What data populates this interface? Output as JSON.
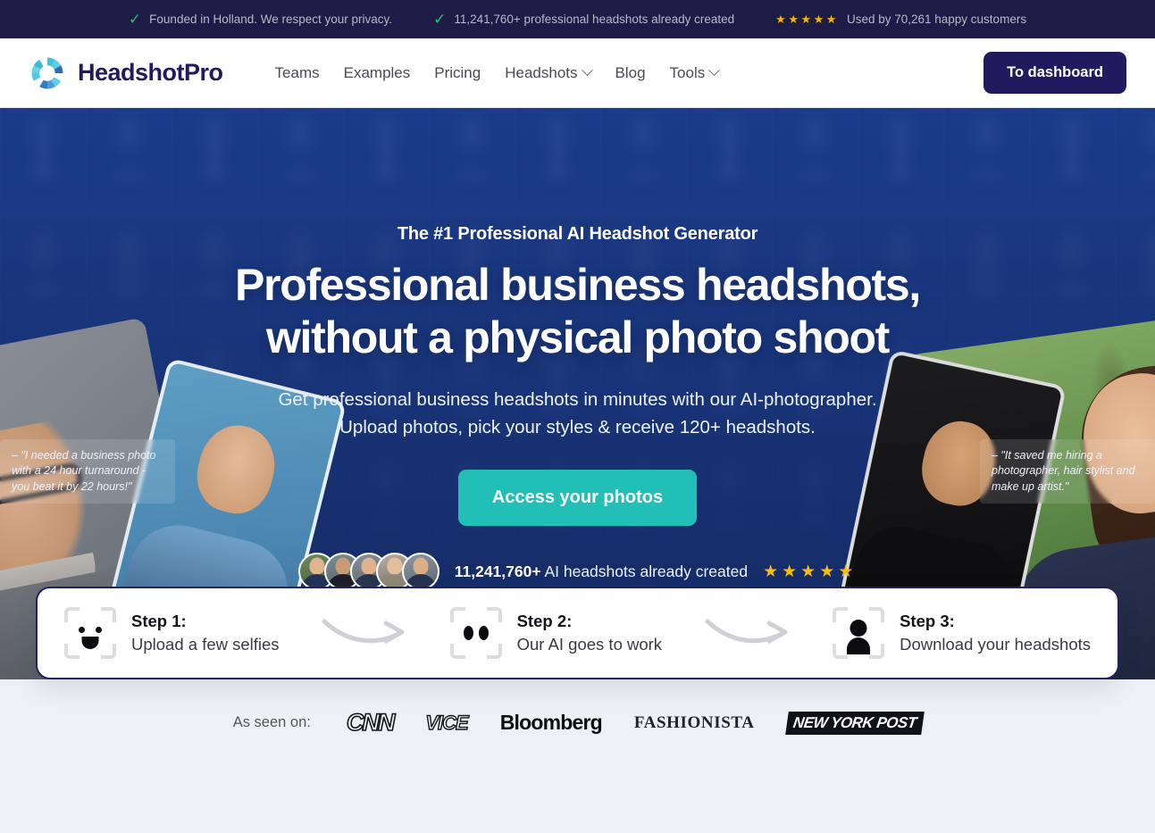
{
  "announcement": {
    "items": [
      {
        "icon": "check-icon",
        "text": "Founded in Holland. We respect your privacy."
      },
      {
        "icon": "check-icon",
        "text": "11,241,760+ professional headshots already created"
      },
      {
        "icon": "stars-icon",
        "stars": "★★★★★",
        "text": "Used by 70,261 happy customers"
      }
    ]
  },
  "header": {
    "brand": "HeadshotPro",
    "nav": [
      {
        "label": "Teams",
        "dropdown": false
      },
      {
        "label": "Examples",
        "dropdown": false
      },
      {
        "label": "Pricing",
        "dropdown": false
      },
      {
        "label": "Headshots",
        "dropdown": true
      },
      {
        "label": "Blog",
        "dropdown": false
      },
      {
        "label": "Tools",
        "dropdown": true
      }
    ],
    "cta": "To dashboard"
  },
  "hero": {
    "eyebrow": "The #1 Professional AI Headshot Generator",
    "headline_line1": "Professional business headshots,",
    "headline_line2": "without a physical photo shoot",
    "sub_line1": "Get professional business headshots in minutes with our AI-photographer.",
    "sub_line2": "Upload photos, pick your styles & receive 120+ headshots.",
    "cta": "Access your photos",
    "proof_count": "11,241,760+",
    "proof_text": " AI headshots already created",
    "stars": "★★★★★",
    "testimonial_left": "– \"I needed a business photo with a 24 hour turnaround - you beat it by 22 hours!\"",
    "testimonial_right": "– \"It saved me hiring a photographer, hair stylist and make up artist.\""
  },
  "steps": [
    {
      "icon": "face-smile-scan-icon",
      "title": "Step 1:",
      "desc": "Upload a few selfies"
    },
    {
      "icon": "face-eyes-scan-icon",
      "title": "Step 2:",
      "desc": "Our AI goes to work"
    },
    {
      "icon": "person-scan-icon",
      "title": "Step 3:",
      "desc": "Download your headshots"
    }
  ],
  "press": {
    "label": "As seen on:",
    "logos": [
      "CNN",
      "VICE",
      "Bloomberg",
      "FASHIONISTA",
      "NEW YORK POST"
    ]
  },
  "colors": {
    "announce_bg": "#1e1b46",
    "brand_navy": "#221a5e",
    "hero_blue": "#19398a",
    "teal_cta": "#21bfb5",
    "star_gold": "#f5bd10",
    "check_green": "#2fbd6e",
    "page_bg": "#eef0f5"
  }
}
